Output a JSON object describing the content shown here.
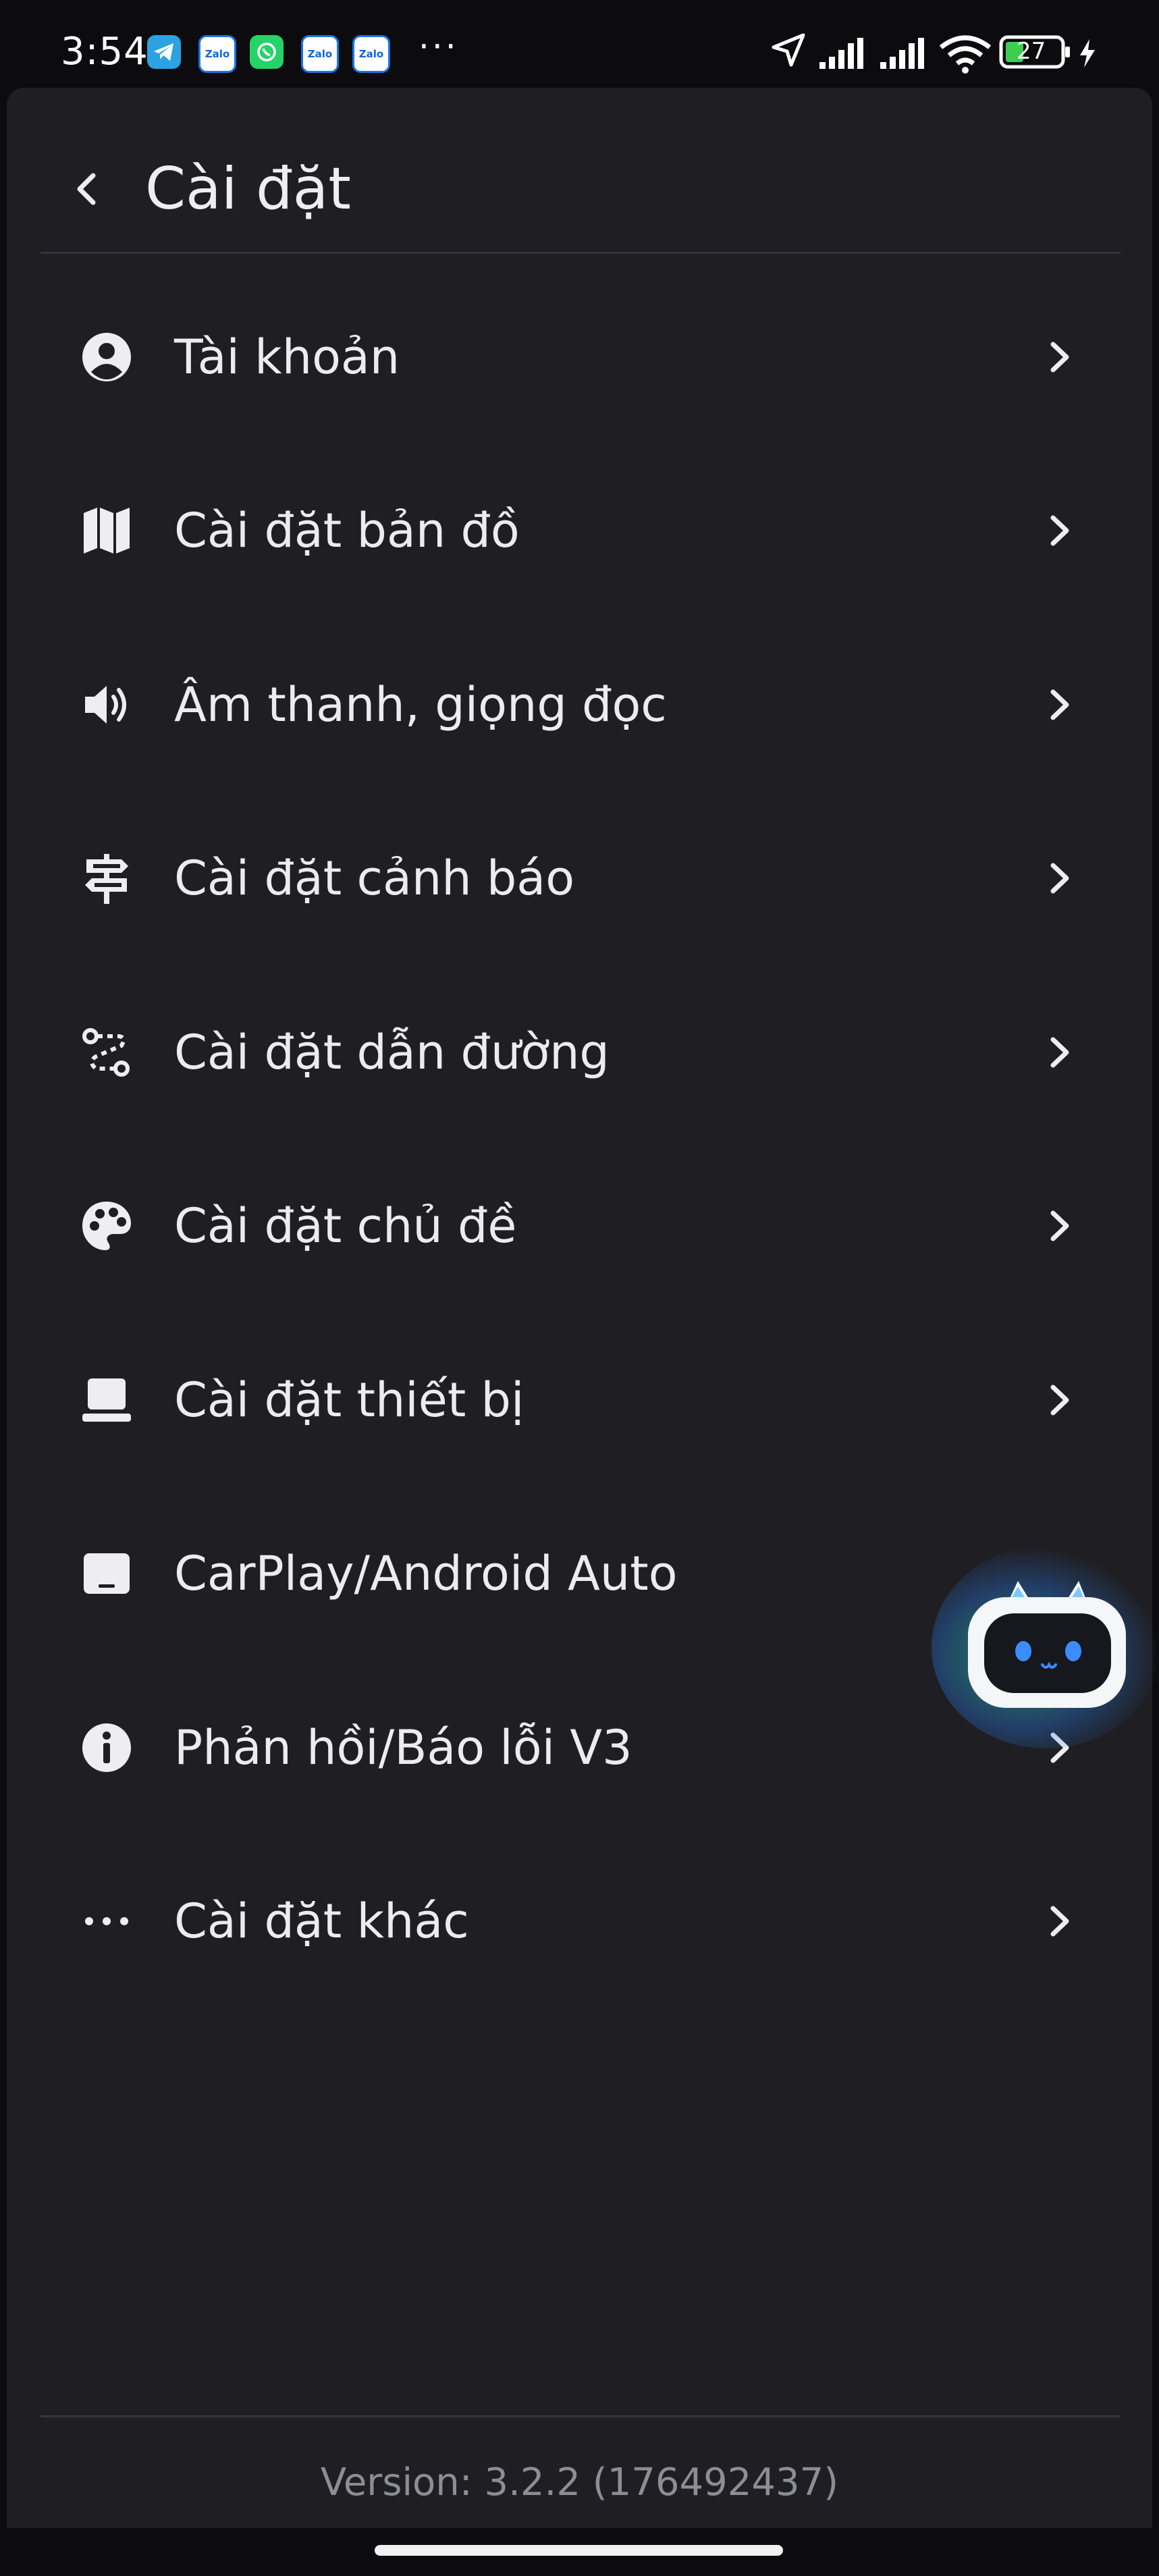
{
  "status_bar": {
    "time": "3:54",
    "apps": [
      "telegram-icon",
      "zalo-icon",
      "whatsapp-icon",
      "zalo-icon",
      "zalo-icon"
    ],
    "zalo_text": "Zalo",
    "more": "···",
    "battery": "27"
  },
  "header": {
    "title": "Cài đặt"
  },
  "menu": {
    "items": [
      {
        "label": "Tài khoản",
        "icon": "account-circle-icon",
        "chevron": true
      },
      {
        "label": "Cài đặt bản đồ",
        "icon": "map-icon",
        "chevron": true
      },
      {
        "label": "Âm thanh, giọng đọc",
        "icon": "speaker-icon",
        "chevron": true
      },
      {
        "label": "Cài đặt cảnh báo",
        "icon": "signpost-icon",
        "chevron": true
      },
      {
        "label": "Cài đặt dẫn đường",
        "icon": "route-icon",
        "chevron": true
      },
      {
        "label": "Cài đặt chủ đề",
        "icon": "palette-icon",
        "chevron": true
      },
      {
        "label": "Cài đặt thiết bị",
        "icon": "laptop-icon",
        "chevron": true
      },
      {
        "label": "CarPlay/Android Auto",
        "icon": "tablet-icon",
        "chevron": false
      },
      {
        "label": "Phản hồi/Báo lỗi V3",
        "icon": "info-icon",
        "chevron": true
      },
      {
        "label": "Cài đặt khác",
        "icon": "more-horizontal-icon",
        "chevron": true
      }
    ]
  },
  "footer": {
    "version": "Version: 3.2.2 (176492437)"
  },
  "colors": {
    "background": "#1f1f23",
    "text": "#ececef",
    "muted": "#8d8d95",
    "divider": "#35353b"
  }
}
